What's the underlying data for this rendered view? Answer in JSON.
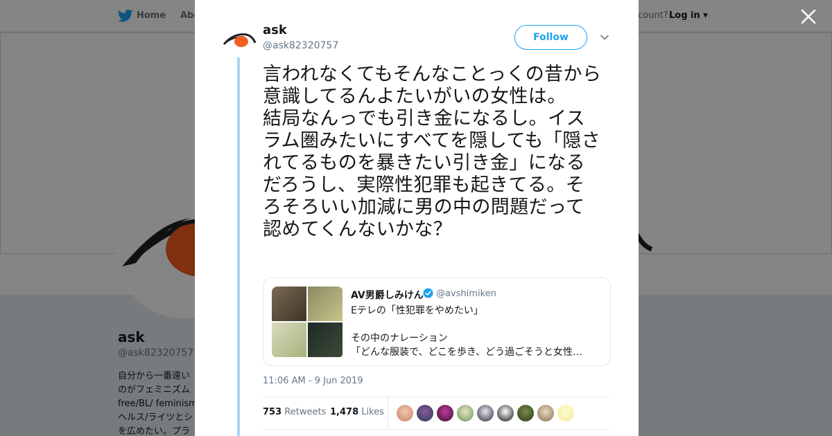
{
  "nav": {
    "home": "Home",
    "about": "Abo",
    "have_account": "account?",
    "login": "Log in"
  },
  "profile": {
    "name": "ask",
    "handle": "@ask82320757",
    "bio_lines": [
      "自分から一番遠い",
      "のがフェミニズム",
      "free/BL/ feminism",
      "ヘルス/ライツとシ",
      "を広めたい。プラ"
    ]
  },
  "tweet": {
    "author_name": "ask",
    "author_handle": "@ask82320757",
    "follow_label": "Follow",
    "text_paragraphs": [
      "言われなくてもそんなことっくの昔から意識してるんよたいがいの女性は。",
      "結局なんっでも引き金になるし。イスラム圏みたいにすべてを隠しても「隠されてるものを暴きたい引き金」になるだろうし、実際性犯罪も起きてる。そろそろいい加減に男の中の問題だって認めてくんないかな？"
    ],
    "quoted": {
      "name": "AV男爵しみけん",
      "handle": "@avshimiken",
      "line1": "Eテレの「性犯罪をやめたい」",
      "line2": "その中のナレーション",
      "line3": "「どんな服装で、どこを歩き、どう過ごそうと女性…"
    },
    "timestamp": "11:06 AM - 9 Jun 2019",
    "retweets_count": "753",
    "retweets_label": "Retweets",
    "likes_count": "1,478",
    "likes_label": "Likes"
  },
  "colors": {
    "brand_blue": "#1da1f2",
    "thread_line": "#a6d5f4",
    "avatar_orange": "#f45d22"
  },
  "icons": {
    "logo": "twitter-bird-icon",
    "close": "close-icon",
    "caret": "chevron-down-icon",
    "verified": "verified-badge-icon"
  }
}
